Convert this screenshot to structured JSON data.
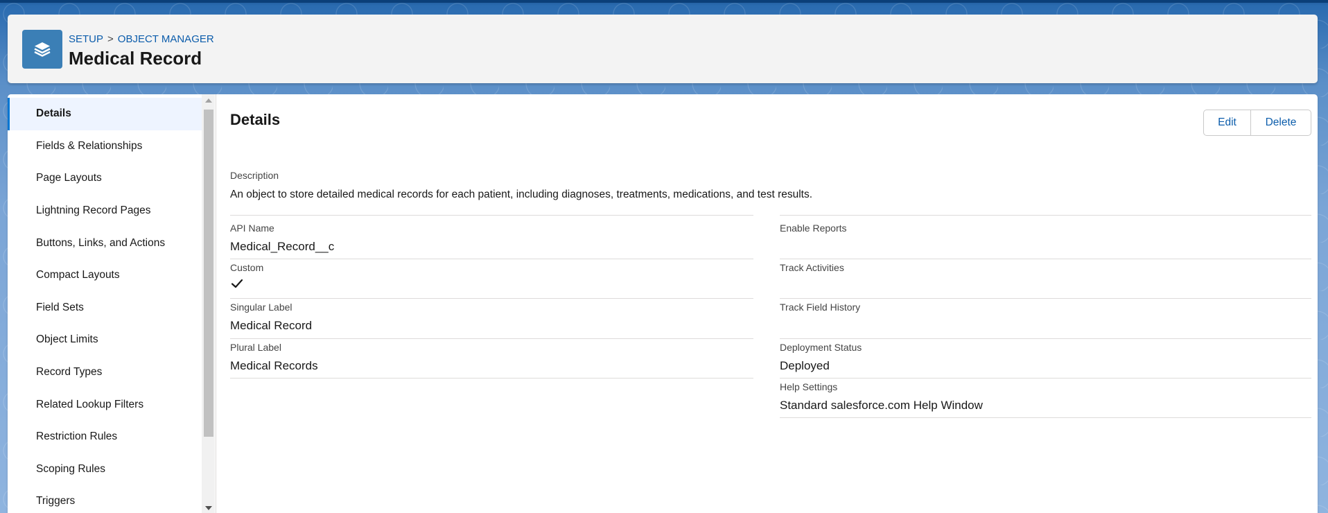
{
  "header": {
    "breadcrumb": [
      "SETUP",
      "OBJECT MANAGER"
    ],
    "breadcrumb_separator": ">",
    "title": "Medical Record",
    "icon": "layers-icon"
  },
  "sidebar": {
    "items": [
      {
        "label": "Details",
        "active": true
      },
      {
        "label": "Fields & Relationships"
      },
      {
        "label": "Page Layouts"
      },
      {
        "label": "Lightning Record Pages"
      },
      {
        "label": "Buttons, Links, and Actions"
      },
      {
        "label": "Compact Layouts"
      },
      {
        "label": "Field Sets"
      },
      {
        "label": "Object Limits"
      },
      {
        "label": "Record Types"
      },
      {
        "label": "Related Lookup Filters"
      },
      {
        "label": "Restriction Rules"
      },
      {
        "label": "Scoping Rules"
      },
      {
        "label": "Triggers"
      }
    ]
  },
  "details": {
    "title": "Details",
    "buttons": {
      "edit": "Edit",
      "delete": "Delete"
    },
    "description_label": "Description",
    "description": "An object to store detailed medical records for each patient, including diagnoses, treatments, medications, and test results.",
    "left_fields": [
      {
        "label": "API Name",
        "value": "Medical_Record__c"
      },
      {
        "label": "Custom",
        "value": "",
        "checked": true
      },
      {
        "label": "Singular Label",
        "value": "Medical Record"
      },
      {
        "label": "Plural Label",
        "value": "Medical Records"
      }
    ],
    "right_fields": [
      {
        "label": "Enable Reports",
        "value": ""
      },
      {
        "label": "Track Activities",
        "value": ""
      },
      {
        "label": "Track Field History",
        "value": ""
      },
      {
        "label": "Deployment Status",
        "value": "Deployed"
      },
      {
        "label": "Help Settings",
        "value": "Standard salesforce.com Help Window"
      }
    ]
  },
  "colors": {
    "accent": "#0176d3",
    "link": "#0b5cab",
    "icon_bg": "#3b7fb6"
  }
}
